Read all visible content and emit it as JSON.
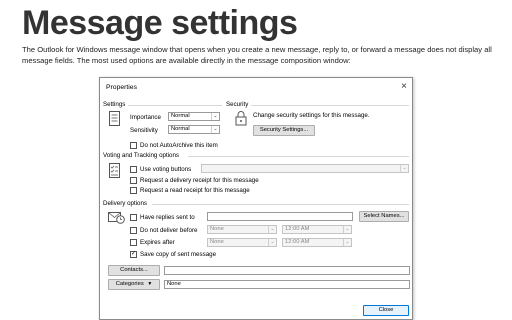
{
  "page": {
    "title": "Message settings",
    "intro": "The Outlook for Windows message window that opens when you create a new message, reply to, or forward a message does not display all message fields. The most used options are available directly in the message composition window:"
  },
  "dialog": {
    "title": "Properties",
    "close_icon": "×",
    "settings": {
      "label": "Settings",
      "importance_label": "Importance",
      "importance_value": "Normal",
      "sensitivity_label": "Sensitivity",
      "sensitivity_value": "Normal",
      "no_autoarchive": "Do not AutoArchive this item",
      "no_autoarchive_checked": false
    },
    "security": {
      "label": "Security",
      "description": "Change security settings for this message.",
      "button": "Security Settings..."
    },
    "voting": {
      "label": "Voting and Tracking options",
      "use_voting": "Use voting buttons",
      "use_voting_checked": false,
      "use_voting_value": "",
      "delivery_receipt": "Request a delivery receipt for this message",
      "delivery_receipt_checked": false,
      "read_receipt": "Request a read receipt for this message",
      "read_receipt_checked": false
    },
    "delivery": {
      "label": "Delivery options",
      "replies_sent_to": "Have replies sent to",
      "replies_sent_to_checked": false,
      "replies_sent_to_value": "",
      "select_names": "Select Names...",
      "do_not_deliver": "Do not deliver before",
      "do_not_deliver_checked": false,
      "do_not_deliver_date": "None",
      "do_not_deliver_time": "12:00 AM",
      "expires_after": "Expires after",
      "expires_after_checked": false,
      "expires_after_date": "None",
      "expires_after_time": "12:00 AM",
      "save_copy": "Save copy of sent message",
      "save_copy_checked": true
    },
    "contacts_button": "Contacts...",
    "contacts_value": "",
    "categories_button": "Categories",
    "categories_value": "None",
    "close_button": "Close"
  },
  "icons": {
    "settings": "document-list-icon",
    "security": "lock-icon",
    "voting": "voting-list-icon",
    "delivery": "envelope-clock-icon"
  }
}
